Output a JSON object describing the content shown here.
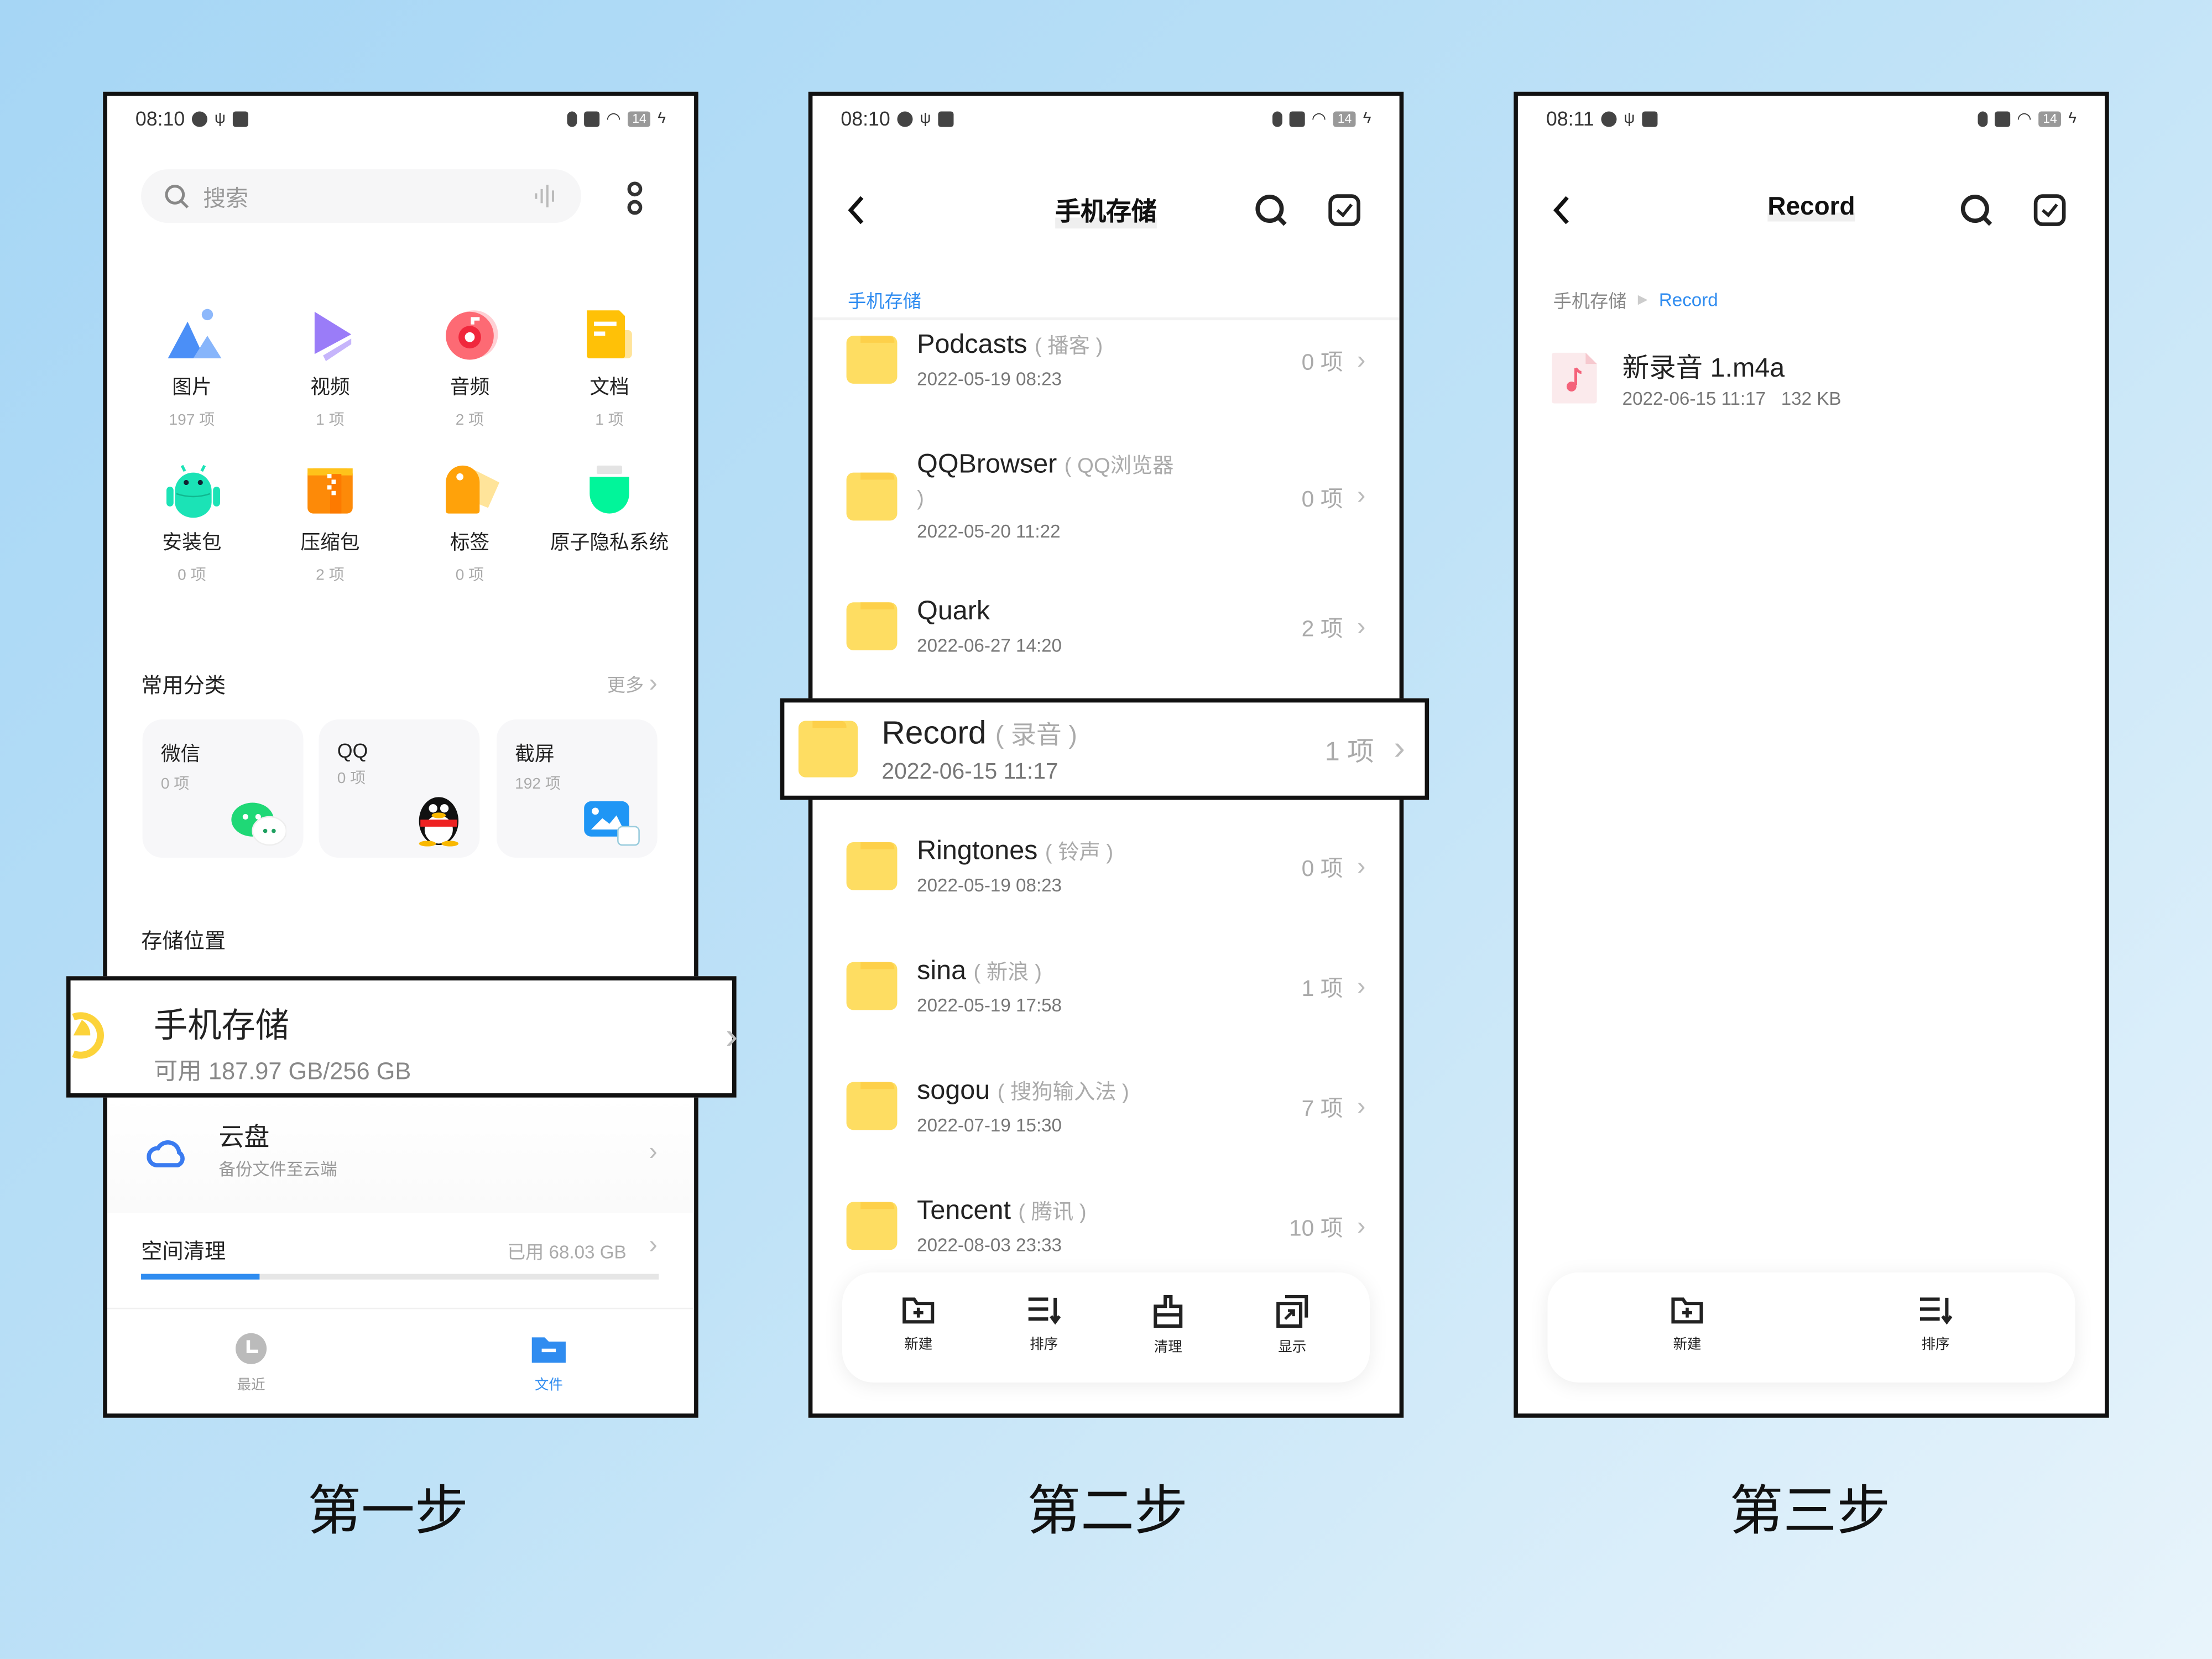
{
  "colors": {
    "accent": "#2f8cf0",
    "folder": "#fedd62",
    "highlight_border": "#111111"
  },
  "phone1": {
    "status": {
      "time": "08:10",
      "battery": "14"
    },
    "search": {
      "placeholder": "搜索"
    },
    "categories": [
      {
        "label": "图片",
        "count": "197 项",
        "icon": "image-icon"
      },
      {
        "label": "视频",
        "count": "1 项",
        "icon": "video-icon"
      },
      {
        "label": "音频",
        "count": "2 项",
        "icon": "audio-icon"
      },
      {
        "label": "文档",
        "count": "1 项",
        "icon": "document-icon"
      },
      {
        "label": "安装包",
        "count": "0 项",
        "icon": "android-icon"
      },
      {
        "label": "压缩包",
        "count": "2 项",
        "icon": "archive-icon"
      },
      {
        "label": "标签",
        "count": "0 项",
        "icon": "tag-icon"
      },
      {
        "label": "原子隐私系统",
        "count": "",
        "icon": "privacy-icon"
      }
    ],
    "common": {
      "title": "常用分类",
      "more": "更多",
      "cards": [
        {
          "title": "微信",
          "count": "0 项"
        },
        {
          "title": "QQ",
          "count": "0 项"
        },
        {
          "title": "截屏",
          "count": "192 项"
        }
      ]
    },
    "storage_title": "存储位置",
    "phone_storage": {
      "title": "手机存储",
      "subtitle": "可用 187.97 GB/256 GB"
    },
    "cloud": {
      "title": "云盘",
      "subtitle": "备份文件至云端"
    },
    "cleanup": {
      "title": "空间清理",
      "used": "已用 68.03 GB",
      "progress": 0.23
    },
    "nav": [
      {
        "label": "最近",
        "active": false
      },
      {
        "label": "文件",
        "active": true
      }
    ]
  },
  "phone2": {
    "status": {
      "time": "08:10",
      "battery": "14"
    },
    "title": "手机存储",
    "breadcrumb": "手机存储",
    "folders": [
      {
        "name": "Podcasts",
        "alias": "( 播客 )",
        "date": "2022-05-19 08:23",
        "count": "0 项"
      },
      {
        "name": "QQBrowser",
        "alias": "( QQ浏览器 )",
        "date": "2022-05-20 11:22",
        "count": "0 项"
      },
      {
        "name": "Quark",
        "alias": "",
        "date": "2022-06-27 14:20",
        "count": "2 项"
      },
      {
        "name": "Record",
        "alias": "( 录音 )",
        "date": "2022-06-15 11:17",
        "count": "1 项",
        "highlighted": true
      },
      {
        "name": "Ringtones",
        "alias": "( 铃声 )",
        "date": "2022-05-19 08:23",
        "count": "0 项"
      },
      {
        "name": "sina",
        "alias": "( 新浪 )",
        "date": "2022-05-19 17:58",
        "count": "1 项"
      },
      {
        "name": "sogou",
        "alias": "( 搜狗输入法 )",
        "date": "2022-07-19 15:30",
        "count": "7 项"
      },
      {
        "name": "Tencent",
        "alias": "( 腾讯 )",
        "date": "2022-08-03 23:33",
        "count": "10 项"
      }
    ],
    "toolbar": [
      {
        "label": "新建"
      },
      {
        "label": "排序"
      },
      {
        "label": "清理"
      },
      {
        "label": "显示"
      }
    ]
  },
  "phone3": {
    "status": {
      "time": "08:11",
      "battery": "14"
    },
    "title": "Record",
    "breadcrumb": [
      "手机存储",
      "Record"
    ],
    "file": {
      "name": "新录音 1.m4a",
      "date": "2022-06-15 11:17",
      "size": "132 KB"
    },
    "toolbar": [
      {
        "label": "新建"
      },
      {
        "label": "排序"
      }
    ]
  },
  "steps": [
    "第一步",
    "第二步",
    "第三步"
  ]
}
